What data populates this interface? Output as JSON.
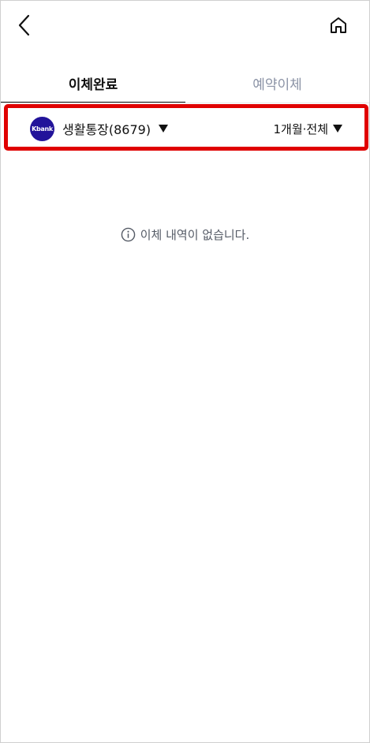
{
  "header": {
    "back_icon": "chevron-left-icon",
    "home_icon": "home-icon"
  },
  "tabs": [
    {
      "label": "이체완료",
      "active": true
    },
    {
      "label": "예약이체",
      "active": false
    }
  ],
  "filter": {
    "bank_logo_text": "Kbank",
    "account_label": "생활통장(8679)",
    "period_label": "1개월·전체"
  },
  "empty_state": {
    "message": "이체 내역이 없습니다."
  },
  "colors": {
    "highlight_border": "#e00000",
    "bank_logo_bg": "#22139a",
    "inactive_tab": "#8b93a6"
  }
}
